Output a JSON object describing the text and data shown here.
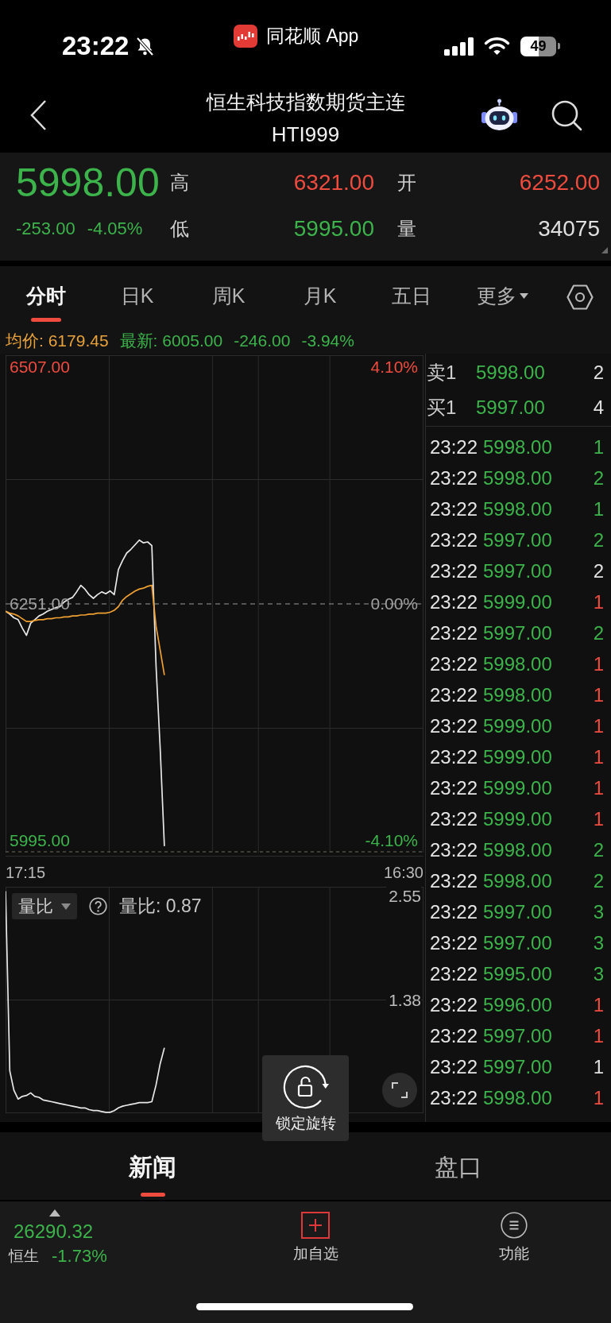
{
  "status_bar": {
    "time": "23:22",
    "app_name": "同花顺 App",
    "battery": "49"
  },
  "header": {
    "title": "恒生科技指数期货主连",
    "code": "HTI999"
  },
  "quote": {
    "price": {
      "text": "5998.00",
      "color": "#3cb44b"
    },
    "changes": [
      {
        "text": "-253.00",
        "color": "#3cb44b"
      },
      {
        "text": "-4.05%",
        "color": "#3cb44b"
      }
    ],
    "stats": [
      {
        "label": "高",
        "value": "6321.00",
        "color": "#f04b3f"
      },
      {
        "label": "开",
        "value": "6252.00",
        "color": "#f04b3f"
      },
      {
        "label": "低",
        "value": "5995.00",
        "color": "#3cb44b"
      },
      {
        "label": "量",
        "value": "34075",
        "color": "#e0e0e0"
      }
    ]
  },
  "tabs": [
    {
      "label": "分时",
      "kind": "tab",
      "selected": true
    },
    {
      "label": "日K",
      "kind": "tab",
      "selected": false
    },
    {
      "label": "周K",
      "kind": "tab",
      "selected": false
    },
    {
      "label": "月K",
      "kind": "tab",
      "selected": false
    },
    {
      "label": "五日",
      "kind": "tab",
      "selected": false
    },
    {
      "label": "更多",
      "kind": "dropdown",
      "selected": false
    }
  ],
  "info_line": [
    {
      "text": "均价: 6179.45",
      "color": "#e9a23b"
    },
    {
      "text": "最新: 6005.00",
      "color": "#3cb44b"
    },
    {
      "text": "-246.00",
      "color": "#3cb44b"
    },
    {
      "text": "-3.94%",
      "color": "#3cb44b"
    }
  ],
  "price_chart": {
    "percent_labels": [
      {
        "text": "4.10%",
        "color": "#f04b3f"
      },
      {
        "text": "0.00%",
        "color": "#a0a0a0"
      },
      {
        "text": "-4.10%",
        "color": "#3cb44b"
      }
    ],
    "time_labels": [
      "17:15",
      "16:30"
    ],
    "chart_data": {
      "type": "line",
      "categories": [
        null,
        null,
        null,
        null,
        null,
        null,
        null,
        null,
        null,
        null,
        null,
        null,
        null,
        null,
        null,
        null,
        null,
        null,
        null,
        null,
        null,
        null,
        null,
        null,
        null,
        null,
        null,
        null,
        null,
        null,
        null,
        null,
        null,
        null,
        null,
        null,
        null,
        null,
        null,
        null,
        null,
        null,
        null,
        null,
        null,
        null,
        null,
        null,
        null,
        null,
        null,
        null,
        null,
        null,
        null,
        null,
        null,
        null,
        null,
        null,
        null,
        null,
        null,
        null,
        null,
        null,
        null,
        null,
        null,
        null,
        null,
        null,
        null,
        null,
        null,
        null,
        null,
        null,
        null,
        null,
        null,
        null,
        null,
        null,
        null,
        null,
        null,
        null,
        null,
        null,
        null,
        null,
        null,
        null,
        null,
        null,
        null,
        null,
        null,
        null,
        null
      ],
      "ylim": [
        5982,
        6520
      ],
      "yticks": [
        {
          "value": 6507,
          "label": "6507.00"
        },
        {
          "value": 6251,
          "label": "6251.00"
        },
        {
          "value": 5995,
          "label": "5995.00"
        }
      ],
      "series": [
        {
          "color": "#e8e8e8",
          "values": [
            6243,
            6240,
            6236,
            6234,
            6225,
            6217,
            6230,
            6234,
            6238,
            6240,
            6243,
            6245,
            6247,
            6248,
            6253,
            6256,
            6258,
            6264,
            6271,
            6267,
            6261,
            6257,
            6261,
            6264,
            6262,
            6265,
            6261,
            6288,
            6298,
            6306,
            6310,
            6315,
            6320,
            6317,
            6318,
            6314,
            6184,
            6095,
            5989,
            null,
            null,
            null,
            null,
            null,
            null,
            null,
            null,
            null,
            null,
            null,
            null,
            null,
            null,
            null,
            null,
            null,
            null,
            null,
            null,
            null,
            null,
            null,
            null,
            null,
            null,
            null,
            null,
            null,
            null,
            null,
            null,
            null,
            null,
            null,
            null,
            null,
            null,
            null,
            null,
            null,
            null,
            null,
            null,
            null,
            null,
            null,
            null,
            null,
            null,
            null,
            null,
            null,
            null,
            null,
            null,
            null,
            null,
            null,
            null,
            null,
            null
          ]
        },
        {
          "color": "#f0a030",
          "values": [
            6243,
            6241,
            6240,
            6238,
            6235,
            6232,
            6232,
            6233,
            6234,
            6234,
            6235,
            6235,
            6236,
            6236,
            6237,
            6237,
            6238,
            6238,
            6239,
            6239,
            6240,
            6240,
            6241,
            6241,
            6241,
            6242,
            6244,
            6248,
            6255,
            6259,
            6262,
            6265,
            6267,
            6268,
            6270,
            6271,
            6227,
            6201,
            6174,
            null,
            null,
            null,
            null,
            null,
            null,
            null,
            null,
            null,
            null,
            null,
            null,
            null,
            null,
            null,
            null,
            null,
            null,
            null,
            null,
            null,
            null,
            null,
            null,
            null,
            null,
            null,
            null,
            null,
            null,
            null,
            null,
            null,
            null,
            null,
            null,
            null,
            null,
            null,
            null,
            null,
            null,
            null,
            null,
            null,
            null,
            null,
            null,
            null,
            null,
            null,
            null,
            null,
            null,
            null,
            null,
            null,
            null,
            null,
            null,
            null,
            null
          ]
        },
        {
          "color": "#9a9a9a",
          "line_style": "dashed",
          "values": [
            6251,
            6251,
            6251,
            6251,
            6251,
            6251,
            6251,
            6251,
            6251,
            6251,
            6251,
            6251,
            6251,
            6251,
            6251,
            6251,
            6251,
            6251,
            6251,
            6251,
            6251,
            6251,
            6251,
            6251,
            6251,
            6251,
            6251,
            6251,
            6251,
            6251,
            6251,
            6251,
            6251,
            6251,
            6251,
            6251,
            6251,
            6251,
            6251,
            6251,
            6251,
            6251,
            6251,
            6251,
            6251,
            6251,
            6251,
            6251,
            6251,
            6251,
            6251,
            6251,
            6251,
            6251,
            6251,
            6251,
            6251,
            6251,
            6251,
            6251,
            6251,
            6251,
            6251,
            6251,
            6251,
            6251,
            6251,
            6251,
            6251,
            6251,
            6251,
            6251,
            6251,
            6251,
            6251,
            6251,
            6251,
            6251,
            6251,
            6251,
            6251,
            6251,
            6251,
            6251,
            6251,
            6251,
            6251,
            6251,
            6251,
            6251,
            6251,
            6251,
            6251,
            6251,
            6251,
            6251,
            6251,
            6251,
            6251,
            6251,
            6251
          ]
        }
      ]
    }
  },
  "ratio_chart": {
    "selector": "量比",
    "reading": "量比: 0.87",
    "chart_data": {
      "type": "line",
      "categories": [
        null,
        null,
        null,
        null,
        null,
        null,
        null,
        null,
        null,
        null,
        null,
        null,
        null,
        null,
        null,
        null,
        null,
        null,
        null,
        null,
        null,
        null,
        null,
        null,
        null,
        null,
        null,
        null,
        null,
        null,
        null,
        null,
        null,
        null,
        null,
        null,
        null,
        null,
        null,
        null,
        null,
        null,
        null,
        null,
        null,
        null,
        null,
        null,
        null,
        null,
        null,
        null,
        null,
        null,
        null,
        null,
        null,
        null,
        null,
        null,
        null,
        null,
        null,
        null,
        null,
        null,
        null,
        null,
        null,
        null,
        null,
        null,
        null,
        null,
        null,
        null,
        null,
        null,
        null,
        null,
        null,
        null,
        null,
        null,
        null,
        null,
        null,
        null,
        null,
        null,
        null,
        null,
        null,
        null,
        null,
        null,
        null,
        null,
        null,
        null,
        null
      ],
      "ylim": [
        0.1,
        2.66
      ],
      "yticks": [
        {
          "value": 2.55,
          "label": "2.55"
        },
        {
          "value": 1.38,
          "label": "1.38"
        }
      ],
      "series": [
        {
          "color": "#e8e8e8",
          "values": [
            2.61,
            0.58,
            0.36,
            0.26,
            0.29,
            0.3,
            0.33,
            0.29,
            0.28,
            0.25,
            0.24,
            0.23,
            0.22,
            0.21,
            0.2,
            0.19,
            0.18,
            0.17,
            0.16,
            0.16,
            0.14,
            0.13,
            0.13,
            0.12,
            0.11,
            0.11,
            0.13,
            0.16,
            0.18,
            0.19,
            0.2,
            0.21,
            0.22,
            0.22,
            0.22,
            0.23,
            0.42,
            0.66,
            0.84,
            null,
            null,
            null,
            null,
            null,
            null,
            null,
            null,
            null,
            null,
            null,
            null,
            null,
            null,
            null,
            null,
            null,
            null,
            null,
            null,
            null,
            null,
            null,
            null,
            null,
            null,
            null,
            null,
            null,
            null,
            null,
            null,
            null,
            null,
            null,
            null,
            null,
            null,
            null,
            null,
            null,
            null,
            null,
            null,
            null,
            null,
            null,
            null,
            null,
            null,
            null,
            null,
            null,
            null,
            null,
            null,
            null,
            null,
            null,
            null,
            null,
            null
          ]
        }
      ]
    }
  },
  "order_book": [
    {
      "label": "卖1",
      "price": "5998.00",
      "volume": "2"
    },
    {
      "label": "买1",
      "price": "5997.00",
      "volume": "4"
    }
  ],
  "trades": [
    {
      "time": "23:22",
      "price": "5998.00",
      "volume": "1",
      "color": "#3cb44b"
    },
    {
      "time": "23:22",
      "price": "5998.00",
      "volume": "2",
      "color": "#3cb44b"
    },
    {
      "time": "23:22",
      "price": "5998.00",
      "volume": "1",
      "color": "#3cb44b"
    },
    {
      "time": "23:22",
      "price": "5997.00",
      "volume": "2",
      "color": "#3cb44b"
    },
    {
      "time": "23:22",
      "price": "5997.00",
      "volume": "2",
      "color": "#e0e0e0"
    },
    {
      "time": "23:22",
      "price": "5999.00",
      "volume": "1",
      "color": "#f04b3f"
    },
    {
      "time": "23:22",
      "price": "5997.00",
      "volume": "2",
      "color": "#3cb44b"
    },
    {
      "time": "23:22",
      "price": "5998.00",
      "volume": "1",
      "color": "#f04b3f"
    },
    {
      "time": "23:22",
      "price": "5998.00",
      "volume": "1",
      "color": "#f04b3f"
    },
    {
      "time": "23:22",
      "price": "5999.00",
      "volume": "1",
      "color": "#f04b3f"
    },
    {
      "time": "23:22",
      "price": "5999.00",
      "volume": "1",
      "color": "#f04b3f"
    },
    {
      "time": "23:22",
      "price": "5999.00",
      "volume": "1",
      "color": "#f04b3f"
    },
    {
      "time": "23:22",
      "price": "5999.00",
      "volume": "1",
      "color": "#f04b3f"
    },
    {
      "time": "23:22",
      "price": "5998.00",
      "volume": "2",
      "color": "#3cb44b"
    },
    {
      "time": "23:22",
      "price": "5998.00",
      "volume": "2",
      "color": "#3cb44b"
    },
    {
      "time": "23:22",
      "price": "5997.00",
      "volume": "3",
      "color": "#3cb44b"
    },
    {
      "time": "23:22",
      "price": "5997.00",
      "volume": "3",
      "color": "#3cb44b"
    },
    {
      "time": "23:22",
      "price": "5995.00",
      "volume": "3",
      "color": "#3cb44b"
    },
    {
      "time": "23:22",
      "price": "5996.00",
      "volume": "1",
      "color": "#f04b3f"
    },
    {
      "time": "23:22",
      "price": "5997.00",
      "volume": "1",
      "color": "#f04b3f"
    },
    {
      "time": "23:22",
      "price": "5997.00",
      "volume": "1",
      "color": "#e0e0e0"
    },
    {
      "time": "23:22",
      "price": "5998.00",
      "volume": "1",
      "color": "#f04b3f"
    }
  ],
  "rotation_lock": {
    "label": "锁定旋转"
  },
  "bottom_tabs": [
    {
      "label": "新闻",
      "selected": true
    },
    {
      "label": "盘口",
      "selected": false
    }
  ],
  "index_quote": {
    "name": "恒生",
    "figures": [
      {
        "text": "26290.32",
        "color": "#3cb44b"
      },
      {
        "text": "-1.73%",
        "color": "#3cb44b"
      }
    ]
  },
  "actions": [
    {
      "label": "加自选",
      "kind": "add"
    },
    {
      "label": "功能",
      "kind": "menu"
    }
  ]
}
